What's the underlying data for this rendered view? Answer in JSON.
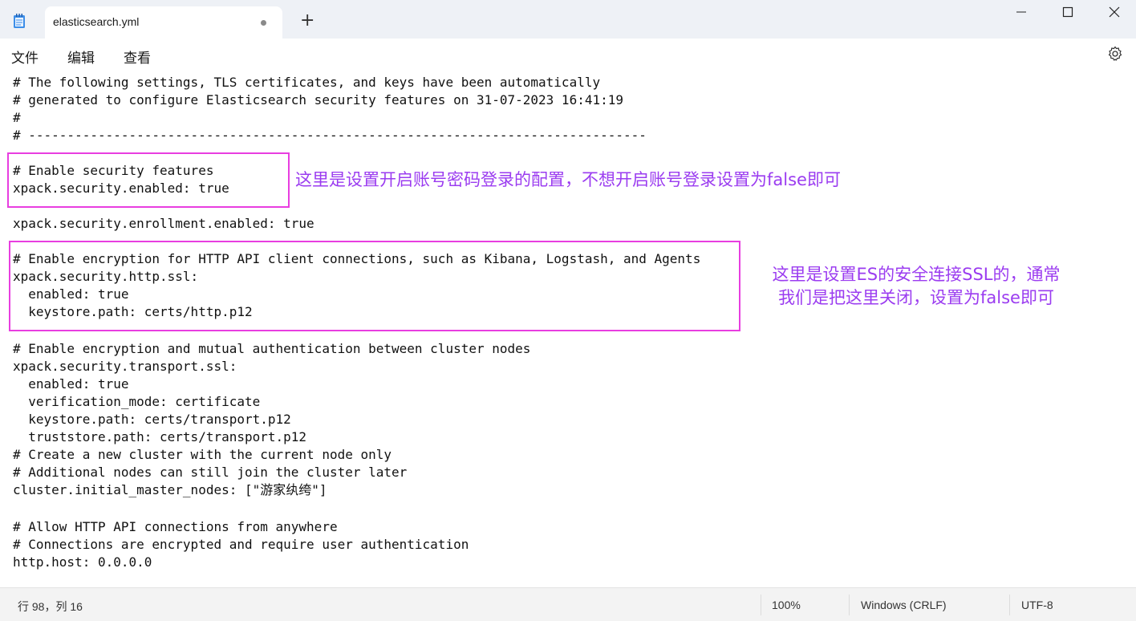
{
  "window": {
    "tab_title": "elasticsearch.yml",
    "new_tab_symbol": "+",
    "minimize_icon": "minimize-icon",
    "maximize_icon": "maximize-icon",
    "close_icon": "close-icon"
  },
  "menu": {
    "file": "文件",
    "edit": "编辑",
    "view": "查看",
    "settings_icon": "gear-icon"
  },
  "editor": {
    "lines": [
      "# The following settings, TLS certificates, and keys have been automatically",
      "# generated to configure Elasticsearch security features on 31-07-2023 16:41:19",
      "#",
      "# --------------------------------------------------------------------------------",
      "",
      "# Enable security features",
      "xpack.security.enabled: true",
      "",
      "xpack.security.enrollment.enabled: true",
      "",
      "# Enable encryption for HTTP API client connections, such as Kibana, Logstash, and Agents",
      "xpack.security.http.ssl:",
      "  enabled: true",
      "  keystore.path: certs/http.p12",
      "",
      "# Enable encryption and mutual authentication between cluster nodes",
      "xpack.security.transport.ssl:",
      "  enabled: true",
      "  verification_mode: certificate",
      "  keystore.path: certs/transport.p12",
      "  truststore.path: certs/transport.p12",
      "# Create a new cluster with the current node only",
      "# Additional nodes can still join the cluster later",
      "cluster.initial_master_nodes: [\"游家纨绔\"]",
      "",
      "# Allow HTTP API connections from anywhere",
      "# Connections are encrypted and require user authentication",
      "http.host: 0.0.0.0"
    ]
  },
  "annotations": {
    "security_note": "这里是设置开启账号密码登录的配置，不想开启账号登录设置为false即可",
    "ssl_note_line1": "这里是设置ES的安全连接SSL的，通常",
    "ssl_note_line2": "我们是把这里关闭，设置为false即可",
    "highlight_color": "#e83ee0",
    "text_color": "#9b3cf0"
  },
  "status": {
    "position": "行 98，列 16",
    "zoom": "100%",
    "line_ending": "Windows (CRLF)",
    "encoding": "UTF-8"
  }
}
